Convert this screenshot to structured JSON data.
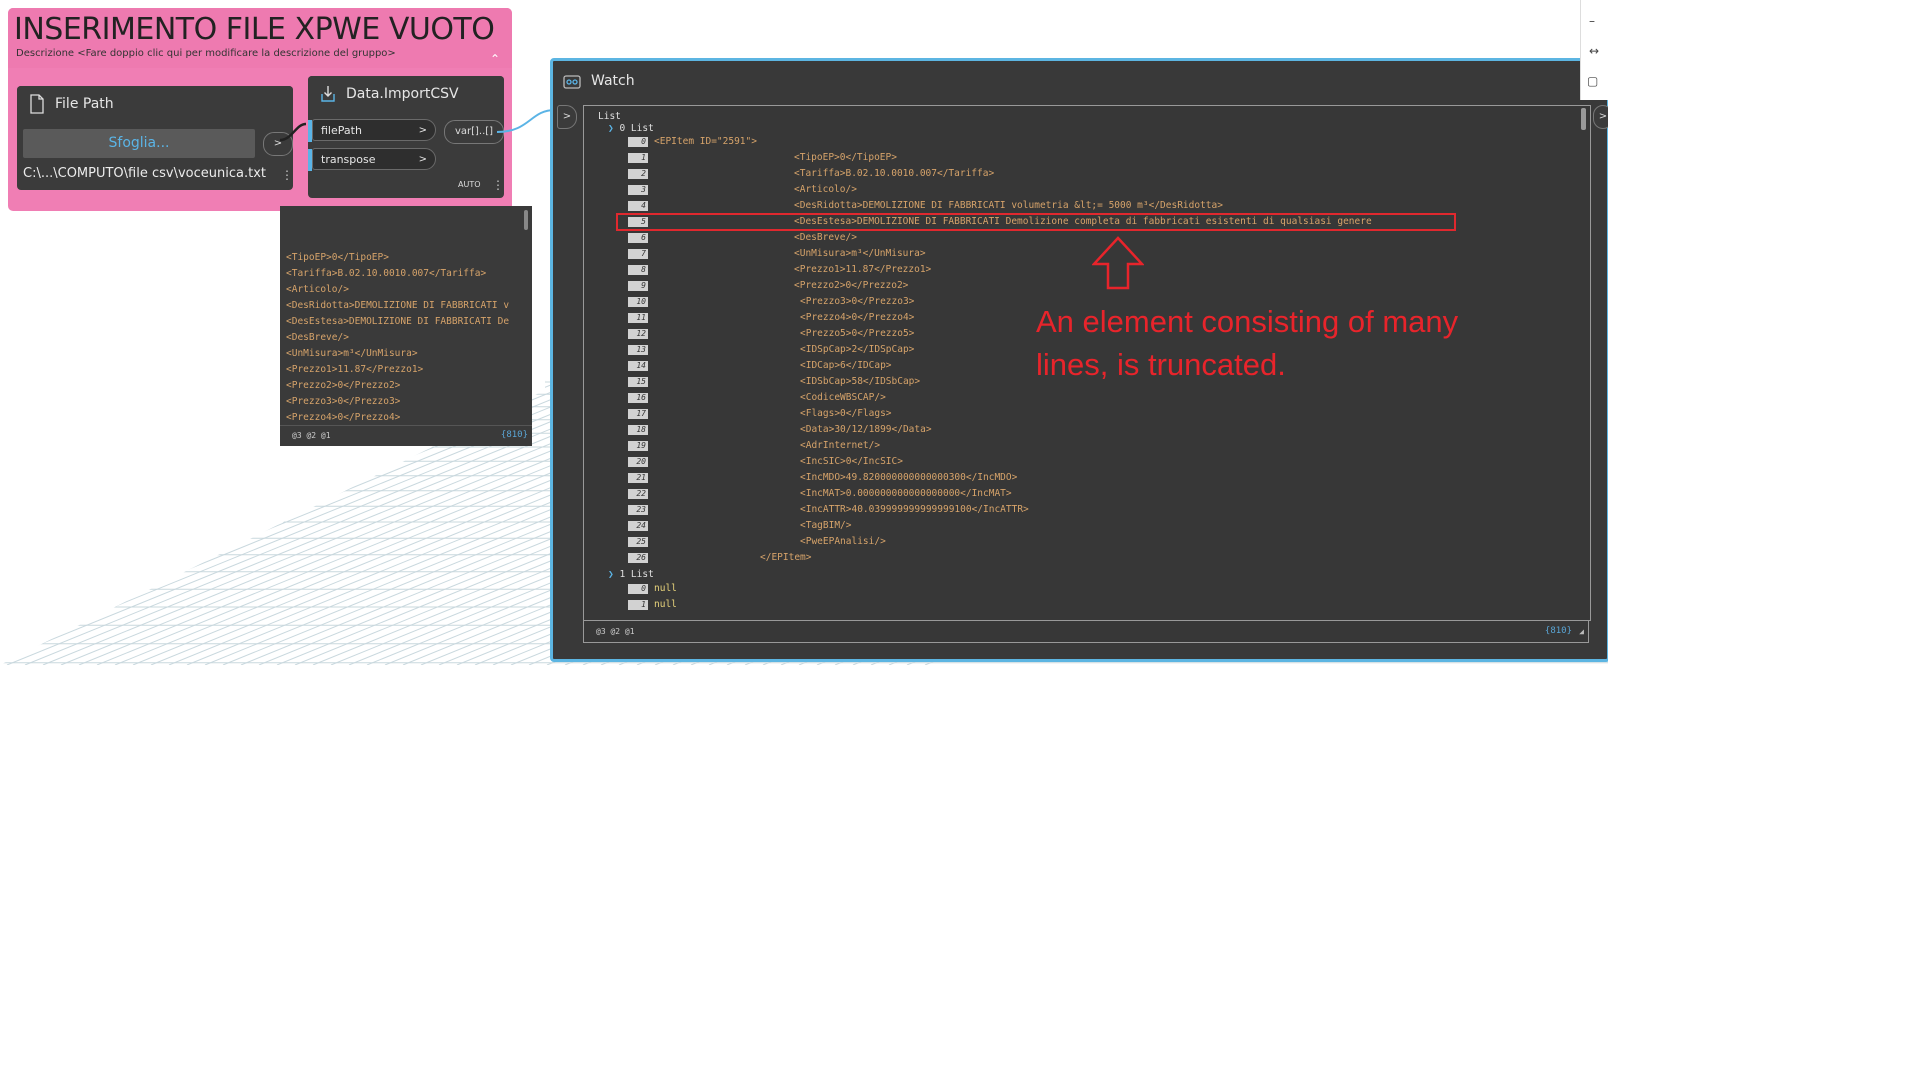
{
  "group": {
    "title": "INSERIMENTO FILE XPWE VUOTO",
    "description": "Descrizione <Fare doppio clic qui per modificare la descrizione del gruppo>"
  },
  "file_path_node": {
    "title": "File Path",
    "browse_label": "Sfoglia...",
    "output_port": ">",
    "value": "C:\\...\\COMPUTO\\file csv\\voceunica.txt"
  },
  "import_node": {
    "title": "Data.ImportCSV",
    "inputs": [
      {
        "label": "filePath",
        "arrow": ">"
      },
      {
        "label": "transpose",
        "arrow": ">"
      }
    ],
    "output": "var[]..[]",
    "lacing": "AUTO"
  },
  "preview": {
    "lines": [
      "<TipoEP>0</TipoEP>",
      "<Tariffa>B.02.10.0010.007</Tariffa>",
      "<Articolo/>",
      "<DesRidotta>DEMOLIZIONE DI FABBRICATI v",
      "<DesEstesa>DEMOLIZIONE DI FABBRICATI De",
      "<DesBreve/>",
      "<UnMisura>m³</UnMisura>",
      "<Prezzo1>11.87</Prezzo1>",
      "<Prezzo2>0</Prezzo2>",
      " <Prezzo3>0</Prezzo3>",
      " <Prezzo4>0</Prezzo4>"
    ],
    "levels": "@3 @2 @1",
    "count": "{810}"
  },
  "watch": {
    "title": "Watch",
    "root": "List",
    "list0_label": "0 List",
    "list1_label": "1 List",
    "items": [
      {
        "i": "0",
        "text": "<EPItem ID=\"2591\">"
      },
      {
        "i": "1",
        "text": "<TipoEP>0</TipoEP>"
      },
      {
        "i": "2",
        "text": "<Tariffa>B.02.10.0010.007</Tariffa>"
      },
      {
        "i": "3",
        "text": "<Articolo/>"
      },
      {
        "i": "4",
        "text": "<DesRidotta>DEMOLIZIONE DI FABBRICATI volumetria &lt;= 5000 m³</DesRidotta>"
      },
      {
        "i": "5",
        "text": "<DesEstesa>DEMOLIZIONE DI FABBRICATI Demolizione completa di fabbricati esistenti di qualsiasi genere"
      },
      {
        "i": "6",
        "text": "<DesBreve/>"
      },
      {
        "i": "7",
        "text": "<UnMisura>m³</UnMisura>"
      },
      {
        "i": "8",
        "text": "<Prezzo1>11.87</Prezzo1>"
      },
      {
        "i": "9",
        "text": "<Prezzo2>0</Prezzo2>"
      },
      {
        "i": "10",
        "text": " <Prezzo3>0</Prezzo3>"
      },
      {
        "i": "11",
        "text": " <Prezzo4>0</Prezzo4>"
      },
      {
        "i": "12",
        "text": " <Prezzo5>0</Prezzo5>"
      },
      {
        "i": "13",
        "text": " <IDSpCap>2</IDSpCap>"
      },
      {
        "i": "14",
        "text": " <IDCap>6</IDCap>"
      },
      {
        "i": "15",
        "text": " <IDSbCap>58</IDSbCap>"
      },
      {
        "i": "16",
        "text": " <CodiceWBSCAP/>"
      },
      {
        "i": "17",
        "text": " <Flags>0</Flags>"
      },
      {
        "i": "18",
        "text": " <Data>30/12/1899</Data>"
      },
      {
        "i": "19",
        "text": " <AdrInternet/>"
      },
      {
        "i": "20",
        "text": " <IncSIC>0</IncSIC>"
      },
      {
        "i": "21",
        "text": " <IncMDO>49.820000000000000300</IncMDO>"
      },
      {
        "i": "22",
        "text": " <IncMAT>0.000000000000000000</IncMAT>"
      },
      {
        "i": "23",
        "text": " <IncATTR>40.039999999999999100</IncATTR>"
      },
      {
        "i": "24",
        "text": " <TagBIM/>"
      },
      {
        "i": "25",
        "text": " <PweEPAnalisi/>"
      },
      {
        "i": "26",
        "text": "</EPItem>"
      }
    ],
    "list1_items": [
      {
        "i": "0",
        "text": "null"
      },
      {
        "i": "1",
        "text": "null"
      }
    ],
    "levels": "@3 @2 @1",
    "count": "{810}"
  },
  "annotation": {
    "line1": "An element consisting of many",
    "line2": "lines, is truncated.",
    "color": "#e8242b"
  },
  "colors": {
    "group_bg": "#f07eb4",
    "node_bg": "#3b3b3b",
    "watch_border": "#5cb5e2",
    "code_text": "#d6a36a"
  }
}
